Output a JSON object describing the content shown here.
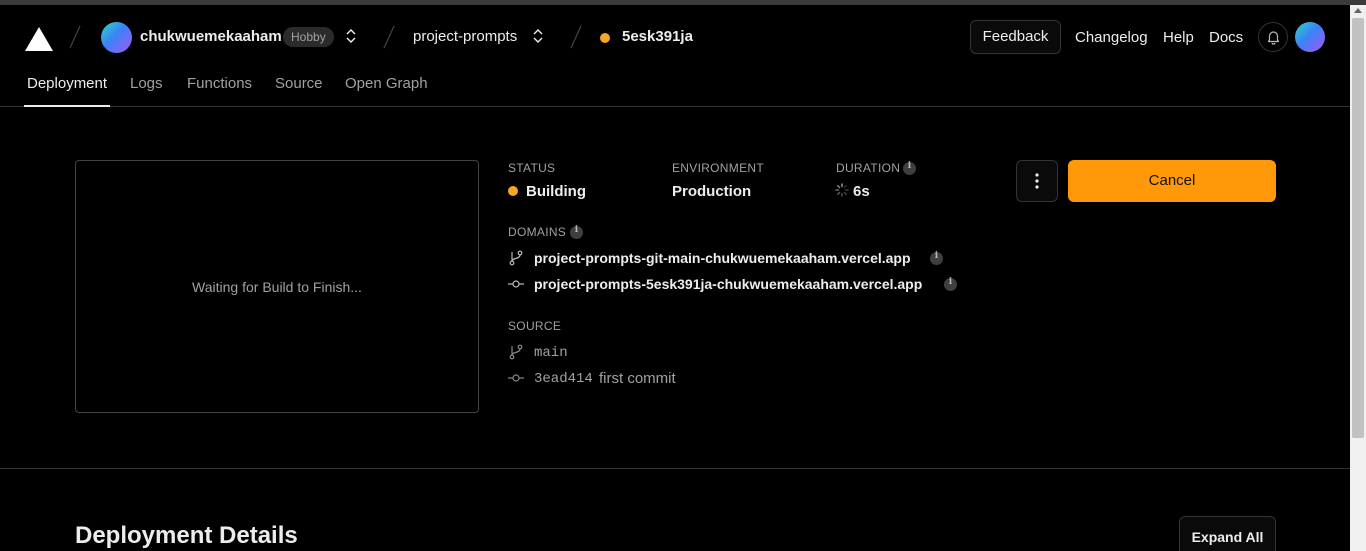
{
  "header": {
    "account_name": "chukwuemekaaham",
    "plan_badge": "Hobby",
    "project_name": "project-prompts",
    "deployment_id": "5esk391ja",
    "feedback_label": "Feedback",
    "links": [
      "Changelog",
      "Help",
      "Docs"
    ]
  },
  "tabs": [
    "Deployment",
    "Logs",
    "Functions",
    "Source",
    "Open Graph"
  ],
  "preview": {
    "message": "Waiting for Build to Finish..."
  },
  "status": {
    "label": "STATUS",
    "value": "Building",
    "color": "#f5a623"
  },
  "environment": {
    "label": "ENVIRONMENT",
    "value": "Production"
  },
  "duration": {
    "label": "DURATION",
    "value": "6s"
  },
  "domains": {
    "label": "DOMAINS",
    "items": [
      {
        "icon": "git-branch-icon",
        "url": "project-prompts-git-main-chukwuemekaaham.vercel.app"
      },
      {
        "icon": "git-commit-icon",
        "url": "project-prompts-5esk391ja-chukwuemekaaham.vercel.app"
      }
    ]
  },
  "source": {
    "label": "SOURCE",
    "branch": "main",
    "commit_hash": "3ead414",
    "commit_message": "first commit"
  },
  "actions": {
    "cancel_label": "Cancel",
    "accent_color": "#ff990a"
  },
  "details": {
    "title": "Deployment Details",
    "expand_label": "Expand All"
  }
}
